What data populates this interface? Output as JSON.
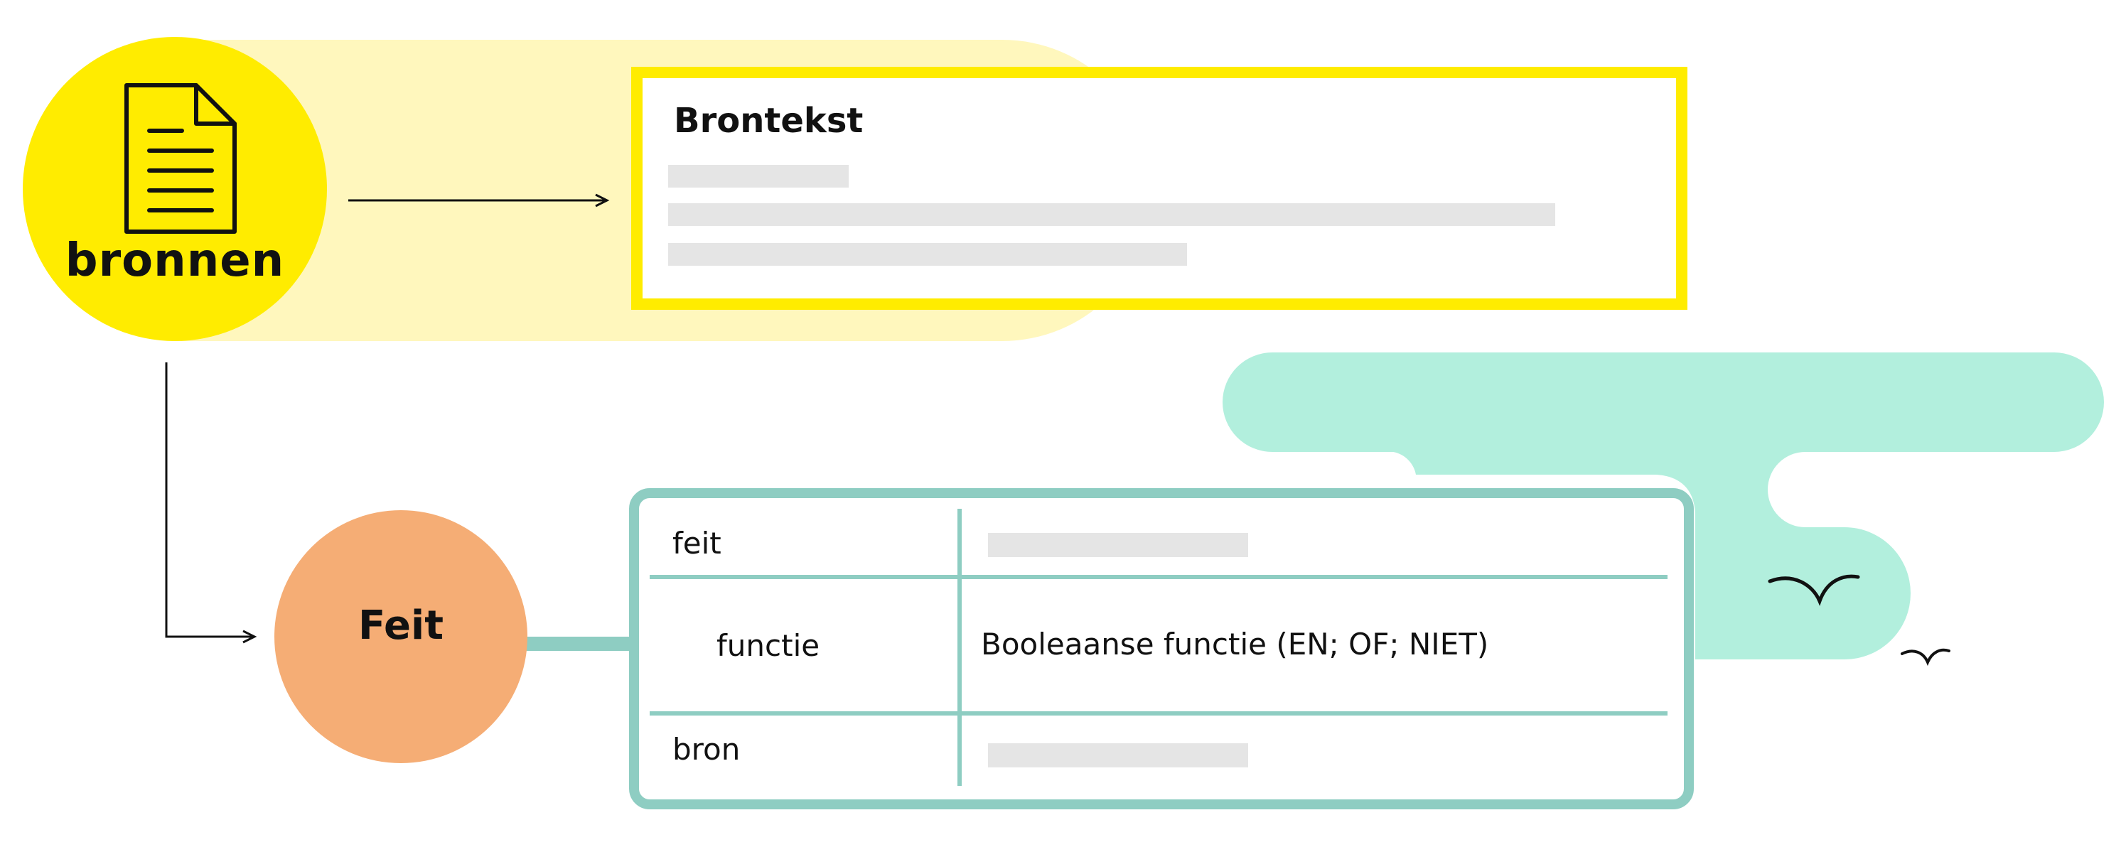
{
  "colors": {
    "yellow": "#FFEC00",
    "yellow_light": "#FFF7BD",
    "mint": "#B2EFDD",
    "teal": "#8ECDC2",
    "orange": "#F5AD75",
    "placeholder": "#E5E5E5",
    "ink": "#111111"
  },
  "source_node": {
    "label": "bronnen",
    "icon": "document-icon"
  },
  "source_card": {
    "title": "Brontekst"
  },
  "fact_node": {
    "label": "Feit"
  },
  "fact_table": {
    "rows": [
      {
        "key": "feit",
        "value": ""
      },
      {
        "key": "functie",
        "value": "Booleaanse functie (EN; OF; NIET)"
      },
      {
        "key": "bron",
        "value": ""
      }
    ]
  },
  "decorations": [
    "cloud-shape",
    "bird-icon",
    "bird-icon"
  ]
}
